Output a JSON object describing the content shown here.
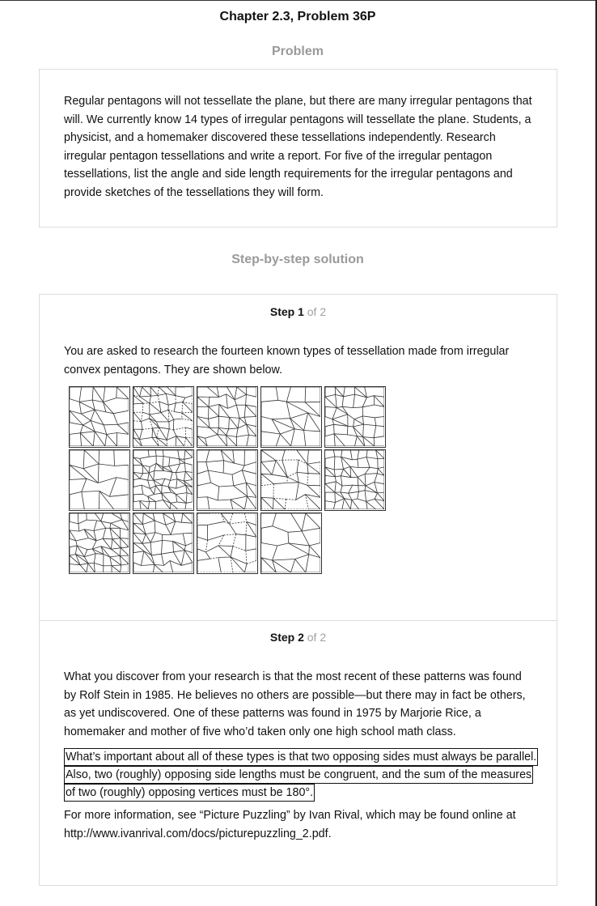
{
  "header": {
    "title": "Chapter 2.3, Problem 36P"
  },
  "problem": {
    "heading": "Problem",
    "lines": [
      "Regular pentagons will not tessellate the plane, but there are many irregular pentagons that",
      "will. We currently know 14 types of irregular pentagons will tessellate the plane. Students, a",
      "physicist, and a homemaker discovered these tessellations independently. Research",
      "irregular pentagon tessellations and write a report. For five of the irregular pentagon",
      "tessellations, list the angle and side length requirements for the irregular pentagons and",
      "provide sketches of the tessellations they will form."
    ]
  },
  "solution": {
    "heading": "Step-by-step solution",
    "step1": {
      "label": "Step 1",
      "of": "of 2",
      "lines": [
        "You are asked to research the fourteen known types of tessellation made from irregular",
        "convex pentagons. They are shown below."
      ],
      "tile_icons": [
        "tessellation-type-1",
        "tessellation-type-2",
        "tessellation-type-3",
        "tessellation-type-4",
        "tessellation-type-5",
        "tessellation-type-6",
        "tessellation-type-7",
        "tessellation-type-8",
        "tessellation-type-9",
        "tessellation-type-10",
        "tessellation-type-11",
        "tessellation-type-12",
        "tessellation-type-13",
        "tessellation-type-14"
      ]
    },
    "step2": {
      "label": "Step 2",
      "of": "of 2",
      "para1": [
        "What you discover from your research is that the most recent of these patterns was found",
        "by Rolf Stein in 1985. He believes no others are possible—but there may in fact be others,",
        "as yet undiscovered. One of these patterns was found in 1975 by Marjorie Rice, a",
        "homemaker and mother of five who’d taken only one high school math class."
      ],
      "boxed": [
        "What’s important about all of these types is that two opposing sides must always be parallel.",
        "Also, two (roughly) opposing side lengths must be congruent, and the sum of the measures",
        "of two (roughly) opposing vertices must be 180°."
      ],
      "para3": [
        "For more information, see “Picture Puzzling” by Ivan Rival, which may be found online at",
        "http://www.ivanrival.com/docs/picturepuzzling_2.pdf."
      ]
    }
  }
}
